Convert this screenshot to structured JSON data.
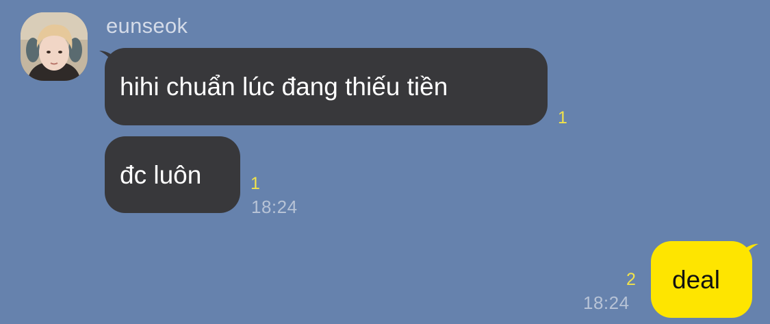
{
  "sender": {
    "name": "eunseok",
    "avatar": "profile-photo"
  },
  "messages": [
    {
      "direction": "incoming",
      "text": "hihi chuẩn lúc đang thiếu tiền",
      "unread": "1",
      "time": ""
    },
    {
      "direction": "incoming",
      "text": "đc luôn",
      "unread": "1",
      "time": "18:24"
    },
    {
      "direction": "outgoing",
      "text": "deal",
      "unread": "2",
      "time": "18:24"
    }
  ],
  "colors": {
    "background": "#6682ad",
    "incoming_bubble": "#38383b",
    "outgoing_bubble": "#fee500",
    "unread_count": "#f2e34a",
    "timestamp": "#b7c3d6",
    "sender_name": "#d4dbe8"
  }
}
